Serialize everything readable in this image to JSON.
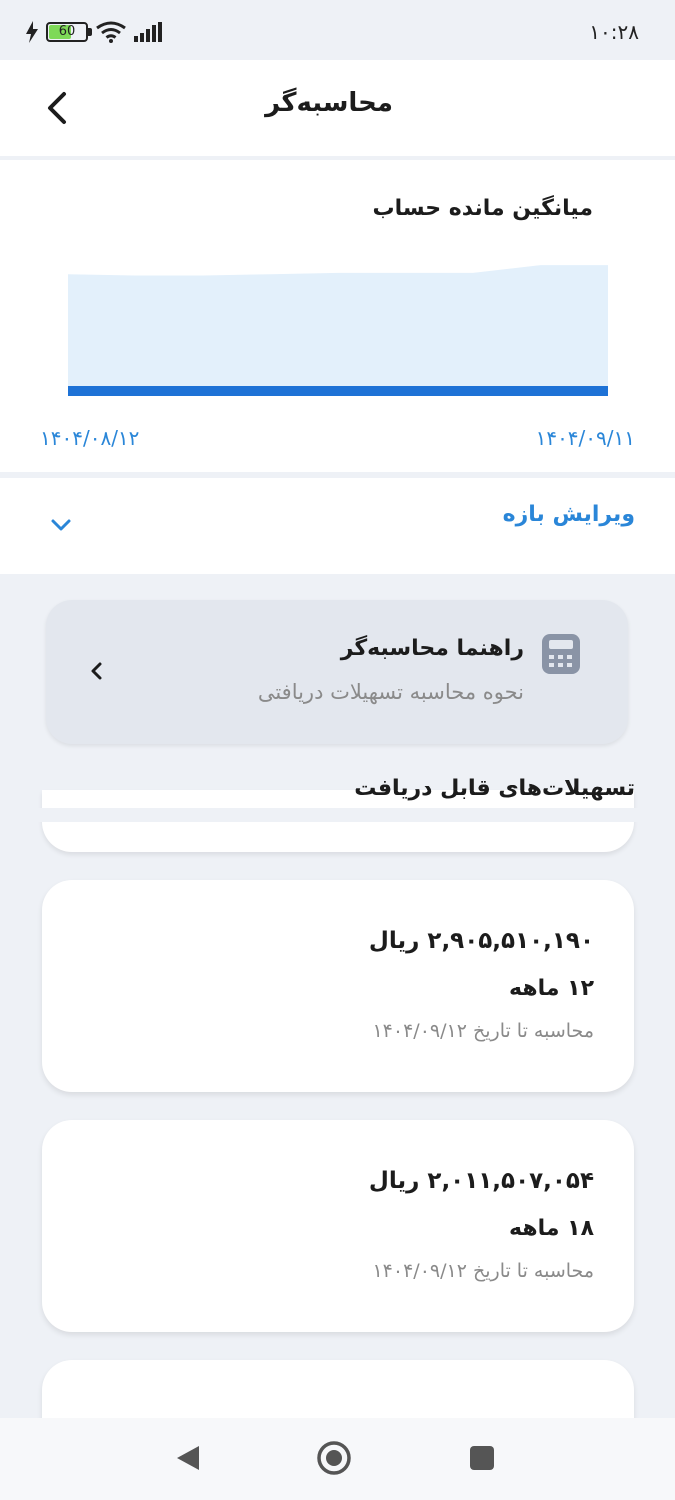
{
  "status_bar": {
    "time": "۱۰:۲۸",
    "battery_level": "60"
  },
  "header": {
    "title": "محاسبه‌گر"
  },
  "chart_section": {
    "title": "میانگین مانده حساب",
    "start_date": "۱۴۰۴/۰۸/۱۲",
    "end_date": "۱۴۰۴/۰۹/۱۱"
  },
  "chart_data": {
    "type": "area",
    "values": [
      0.86,
      0.85,
      0.85,
      0.86,
      0.87,
      0.87,
      0.87,
      0.93,
      0.93
    ],
    "ylim": [
      0,
      1
    ],
    "fill_color": "#e3f0fb",
    "baseline_color": "#1e72d6"
  },
  "range_editor": {
    "label": "ویرایش بازه"
  },
  "guide": {
    "title": "راهنما محاسبه‌گر",
    "subtitle": "نحوه محاسبه تسهیلات دریافتی"
  },
  "loans_section": {
    "title": "تسهیلات‌های قابل دریافت",
    "items": [
      {
        "amount": "۲,۹۰۵,۵۱۰,۱۹۰ ریال",
        "term": "۱۲ ماهه",
        "date_note": "محاسبه تا تاریخ ۱۴۰۴/۰۹/۱۲"
      },
      {
        "amount": "۲,۰۱۱,۵۰۷,۰۵۴ ریال",
        "term": "۱۸ ماهه",
        "date_note": "محاسبه تا تاریخ ۱۴۰۴/۰۹/۱۲"
      }
    ]
  },
  "colors": {
    "accent": "#2a86d8",
    "background": "#eef1f6"
  }
}
